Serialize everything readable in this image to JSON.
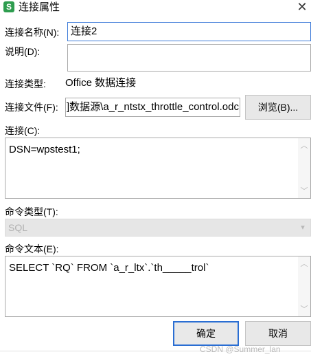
{
  "window": {
    "app_icon": "S",
    "title": "连接属性",
    "close_glyph": "✕"
  },
  "form": {
    "name_label": "连接名称(N):",
    "name_value": "连接2",
    "desc_label": "说明(D):",
    "desc_value": "",
    "type_label": "连接类型:",
    "type_value": "Office 数据连接",
    "file_label": "连接文件(F):",
    "file_value": "]数据源\\a_r_ntstx_throttle_control.odc",
    "browse_label": "浏览(B)...",
    "conn_label": "连接(C):",
    "conn_value": "DSN=wpstest1;",
    "cmdtype_label": "命令类型(T):",
    "cmdtype_value": "SQL",
    "cmdtext_label": "命令文本(E):",
    "cmdtext_value": "SELECT `RQ` FROM `a_r_ltx`.`th_____trol`"
  },
  "buttons": {
    "ok": "确定",
    "cancel": "取消"
  },
  "watermark": "CSDN @Summer_lan"
}
